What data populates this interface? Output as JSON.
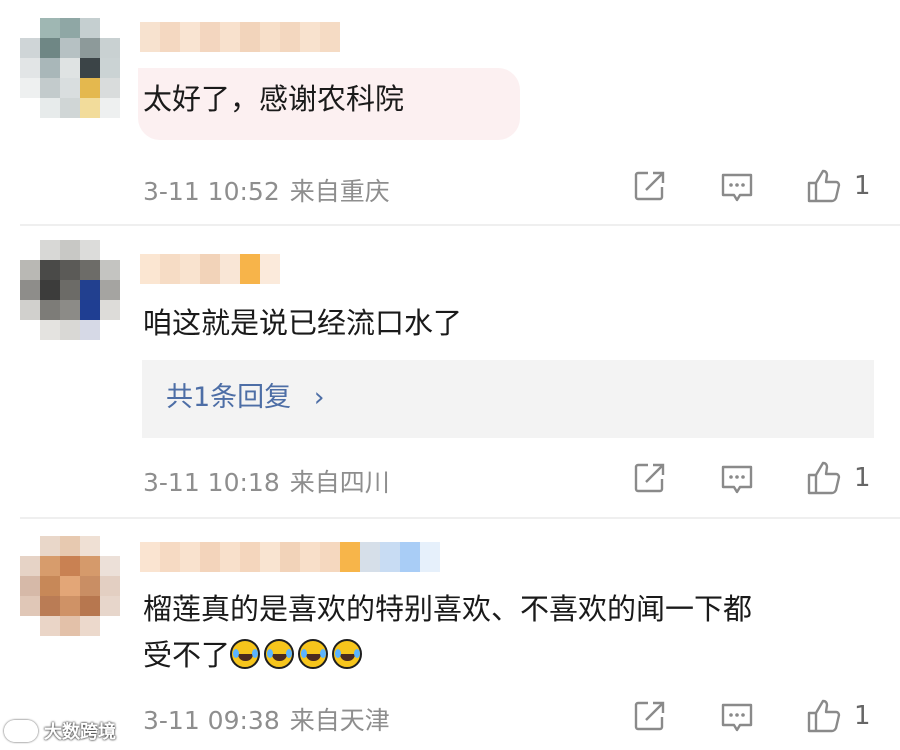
{
  "comments": [
    {
      "text_lines": [
        "太好了，感谢农科院"
      ],
      "time": "3-11 10:52",
      "location": "来自重庆",
      "likes": "1"
    },
    {
      "text_lines": [
        "咱这就是说已经流口水了"
      ],
      "reply_summary": "共1条回复",
      "reply_chevron": "›",
      "time": "3-11 10:18",
      "location": "来自四川",
      "likes": "1"
    },
    {
      "text_lines": [
        "榴莲真的是喜欢的特别喜欢、不喜欢的闻一下都",
        "受不了"
      ],
      "emoji": [
        "laugh-cry",
        "laugh-cry",
        "laugh-cry",
        "laugh-cry"
      ],
      "time": "3-11 09:38",
      "location": "来自天津",
      "likes": "1"
    }
  ],
  "actions": {
    "share_icon": "share-icon",
    "comment_icon": "comment-icon",
    "like_icon": "thumbs-up-icon"
  },
  "watermark": "大数跨境",
  "colors": {
    "reply_link": "#4d6ea6",
    "highlight_bubble": "#fcf0f1",
    "meta_gray": "#8e8e8e"
  }
}
